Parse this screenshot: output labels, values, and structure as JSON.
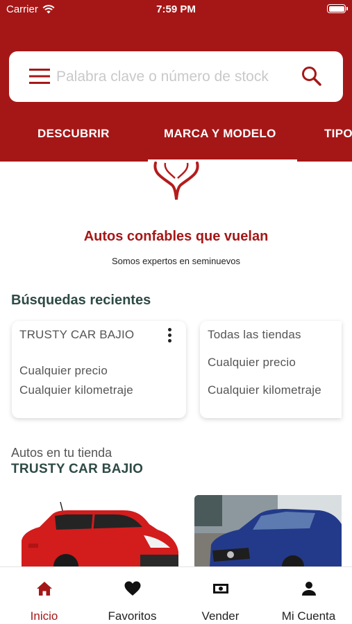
{
  "status_bar": {
    "carrier": "Carrier",
    "time": "7:59 PM"
  },
  "search": {
    "placeholder": "Palabra clave o número de stock"
  },
  "tabs": [
    {
      "label": "DESCUBRIR"
    },
    {
      "label": "MARCA Y MODELO"
    },
    {
      "label": "TIPO"
    }
  ],
  "hero": {
    "tagline": "Autos confables que vuelan",
    "subtagline": "Somos expertos en seminuevos"
  },
  "recent_searches": {
    "title": "Búsquedas recientes",
    "cards": [
      {
        "store": "TRUSTY CAR BAJIO",
        "price": "Cualquier precio",
        "mileage": "Cualquier kilometraje"
      },
      {
        "store": "Todas las tiendas",
        "price": "Cualquier precio",
        "mileage": "Cualquier kilometraje"
      }
    ]
  },
  "store_section": {
    "label": "Autos en tu tienda",
    "store_name": "TRUSTY CAR BAJIO"
  },
  "bottom_nav": [
    {
      "label": "Inicio",
      "icon": "home-icon",
      "active": true
    },
    {
      "label": "Favoritos",
      "icon": "heart-icon",
      "active": false
    },
    {
      "label": "Vender",
      "icon": "money-icon",
      "active": false
    },
    {
      "label": "Mi Cuenta",
      "icon": "user-icon",
      "active": false
    }
  ],
  "colors": {
    "brand": "#a51717",
    "heading": "#2e4a45",
    "placeholder": "#c9c9c9"
  }
}
